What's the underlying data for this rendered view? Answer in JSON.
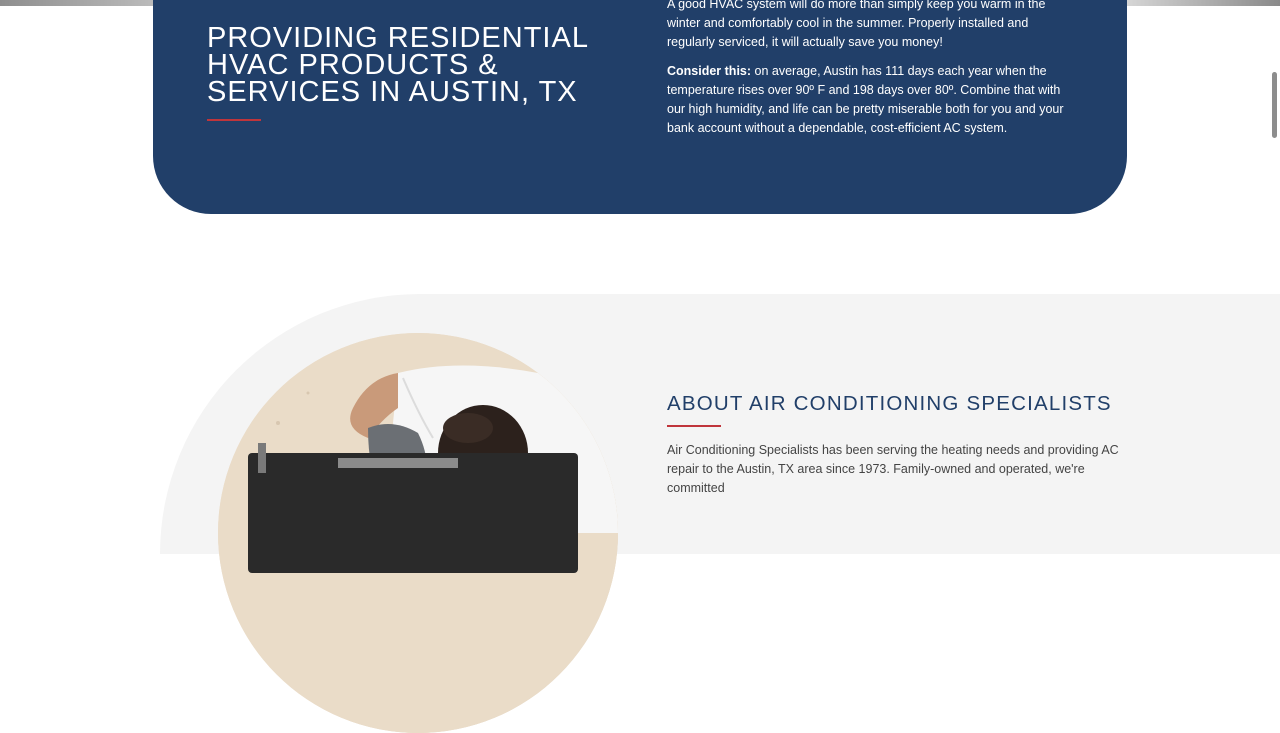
{
  "intro": {
    "heading": "PROVIDING RESIDENTIAL HVAC PRODUCTS & SERVICES IN AUSTIN, TX",
    "paragraph1": "A good HVAC system will do more than simply keep you warm in the winter and comfortably cool in the summer. Properly installed and regularly serviced, it will actually save you money!",
    "paragraph2_lead": "Consider this:",
    "paragraph2_body": " on average, Austin has 111 days each year when the temperature rises over 90º F and 198 days over 80º. Combine that with our high humidity, and life can be pretty miserable both for you and your bank account without a dependable, cost-efficient AC system."
  },
  "about": {
    "heading": "ABOUT AIR CONDITIONING SPECIALISTS",
    "paragraph": "Air Conditioning Specialists has been serving the heating needs and providing AC repair to the Austin, TX area since 1973. Family-owned and operated, we're committed"
  },
  "colors": {
    "navy": "#213f69",
    "accent_red": "#c0353b",
    "light_gray": "#f4f4f4"
  }
}
